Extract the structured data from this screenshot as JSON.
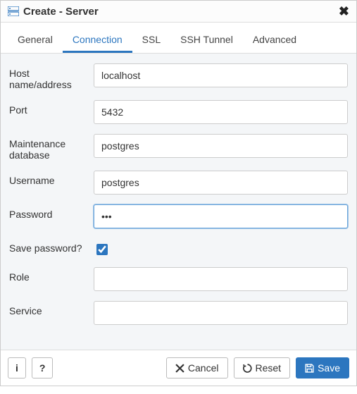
{
  "title": "Create - Server",
  "tabs": {
    "general": "General",
    "connection": "Connection",
    "ssl": "SSL",
    "ssh_tunnel": "SSH Tunnel",
    "advanced": "Advanced"
  },
  "labels": {
    "host": "Host name/address",
    "port": "Port",
    "maintenance_db": "Maintenance database",
    "username": "Username",
    "password": "Password",
    "save_password": "Save password?",
    "role": "Role",
    "service": "Service"
  },
  "values": {
    "host": "localhost",
    "port": "5432",
    "maintenance_db": "postgres",
    "username": "postgres",
    "password": "•••",
    "save_password": true,
    "role": "",
    "service": ""
  },
  "footer": {
    "info": "i",
    "help": "?",
    "cancel": "Cancel",
    "reset": "Reset",
    "save": "Save"
  }
}
